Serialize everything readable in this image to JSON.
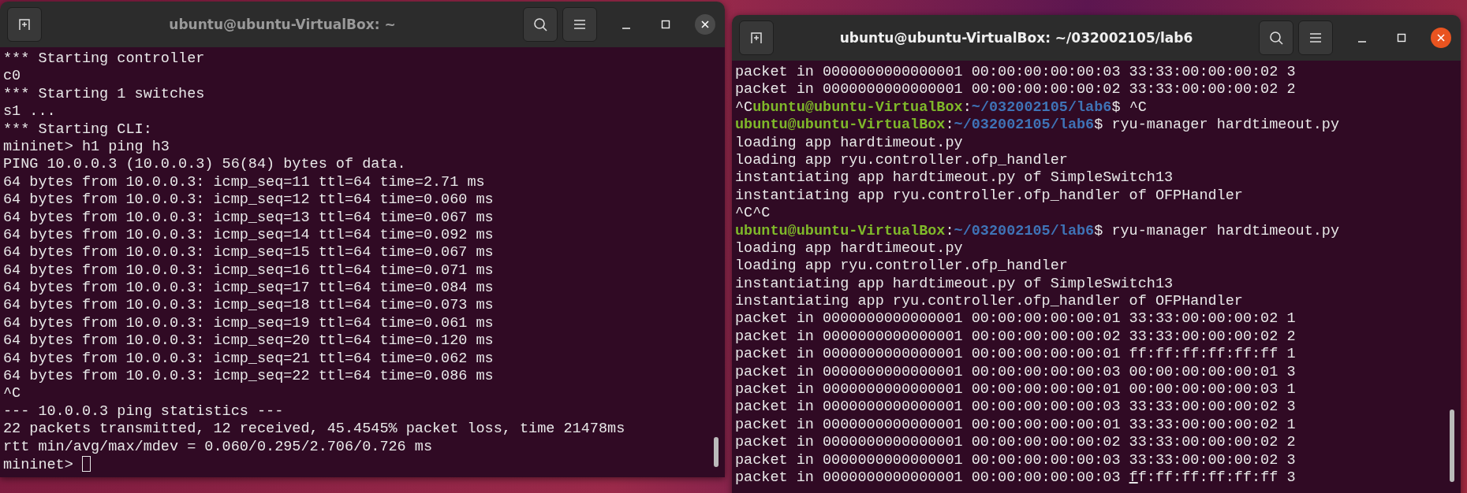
{
  "windows": [
    {
      "title": "ubuntu@ubuntu-VirtualBox: ~",
      "focused": false,
      "lines": [
        {
          "segments": [
            {
              "text": "*** Starting controller",
              "kind": "plain"
            }
          ]
        },
        {
          "segments": [
            {
              "text": "c0",
              "kind": "plain"
            }
          ]
        },
        {
          "segments": [
            {
              "text": "*** Starting 1 switches",
              "kind": "plain"
            }
          ]
        },
        {
          "segments": [
            {
              "text": "s1 ...",
              "kind": "plain"
            }
          ]
        },
        {
          "segments": [
            {
              "text": "*** Starting CLI:",
              "kind": "plain"
            }
          ]
        },
        {
          "segments": [
            {
              "text": "mininet> h1 ping h3",
              "kind": "plain"
            }
          ]
        },
        {
          "segments": [
            {
              "text": "PING 10.0.0.3 (10.0.0.3) 56(84) bytes of data.",
              "kind": "plain"
            }
          ]
        },
        {
          "segments": [
            {
              "text": "64 bytes from 10.0.0.3: icmp_seq=11 ttl=64 time=2.71 ms",
              "kind": "plain"
            }
          ]
        },
        {
          "segments": [
            {
              "text": "64 bytes from 10.0.0.3: icmp_seq=12 ttl=64 time=0.060 ms",
              "kind": "plain"
            }
          ]
        },
        {
          "segments": [
            {
              "text": "64 bytes from 10.0.0.3: icmp_seq=13 ttl=64 time=0.067 ms",
              "kind": "plain"
            }
          ]
        },
        {
          "segments": [
            {
              "text": "64 bytes from 10.0.0.3: icmp_seq=14 ttl=64 time=0.092 ms",
              "kind": "plain"
            }
          ]
        },
        {
          "segments": [
            {
              "text": "64 bytes from 10.0.0.3: icmp_seq=15 ttl=64 time=0.067 ms",
              "kind": "plain"
            }
          ]
        },
        {
          "segments": [
            {
              "text": "64 bytes from 10.0.0.3: icmp_seq=16 ttl=64 time=0.071 ms",
              "kind": "plain"
            }
          ]
        },
        {
          "segments": [
            {
              "text": "64 bytes from 10.0.0.3: icmp_seq=17 ttl=64 time=0.084 ms",
              "kind": "plain"
            }
          ]
        },
        {
          "segments": [
            {
              "text": "64 bytes from 10.0.0.3: icmp_seq=18 ttl=64 time=0.073 ms",
              "kind": "plain"
            }
          ]
        },
        {
          "segments": [
            {
              "text": "64 bytes from 10.0.0.3: icmp_seq=19 ttl=64 time=0.061 ms",
              "kind": "plain"
            }
          ]
        },
        {
          "segments": [
            {
              "text": "64 bytes from 10.0.0.3: icmp_seq=20 ttl=64 time=0.120 ms",
              "kind": "plain"
            }
          ]
        },
        {
          "segments": [
            {
              "text": "64 bytes from 10.0.0.3: icmp_seq=21 ttl=64 time=0.062 ms",
              "kind": "plain"
            }
          ]
        },
        {
          "segments": [
            {
              "text": "64 bytes from 10.0.0.3: icmp_seq=22 ttl=64 time=0.086 ms",
              "kind": "plain"
            }
          ]
        },
        {
          "segments": [
            {
              "text": "^C",
              "kind": "plain"
            }
          ]
        },
        {
          "segments": [
            {
              "text": "--- 10.0.0.3 ping statistics ---",
              "kind": "plain"
            }
          ]
        },
        {
          "segments": [
            {
              "text": "22 packets transmitted, 12 received, 45.4545% packet loss, time 21478ms",
              "kind": "plain"
            }
          ]
        },
        {
          "segments": [
            {
              "text": "rtt min/avg/max/mdev = 0.060/0.295/2.706/0.726 ms",
              "kind": "plain"
            }
          ]
        },
        {
          "segments": [
            {
              "text": "mininet> ",
              "kind": "plain"
            }
          ],
          "cursor_shown": true
        }
      ]
    },
    {
      "title": "ubuntu@ubuntu-VirtualBox: ~/032002105/lab6",
      "focused": true,
      "lines": [
        {
          "segments": [
            {
              "text": "packet in 0000000000000001 00:00:00:00:00:03 33:33:00:00:00:02 3",
              "kind": "plain"
            }
          ]
        },
        {
          "segments": [
            {
              "text": "packet in 0000000000000001 00:00:00:00:00:02 33:33:00:00:00:02 2",
              "kind": "plain"
            }
          ]
        },
        {
          "segments": [
            {
              "text": "^C",
              "kind": "plain"
            },
            {
              "text": "ubuntu@ubuntu-VirtualBox",
              "kind": "user"
            },
            {
              "text": ":",
              "kind": "plain"
            },
            {
              "text": "~/032002105/lab6",
              "kind": "path"
            },
            {
              "text": "$ ^C",
              "kind": "plain"
            }
          ]
        },
        {
          "segments": [
            {
              "text": "ubuntu@ubuntu-VirtualBox",
              "kind": "user"
            },
            {
              "text": ":",
              "kind": "plain"
            },
            {
              "text": "~/032002105/lab6",
              "kind": "path"
            },
            {
              "text": "$ ryu-manager hardtimeout.py",
              "kind": "plain"
            }
          ]
        },
        {
          "segments": [
            {
              "text": "loading app hardtimeout.py",
              "kind": "plain"
            }
          ]
        },
        {
          "segments": [
            {
              "text": "loading app ryu.controller.ofp_handler",
              "kind": "plain"
            }
          ]
        },
        {
          "segments": [
            {
              "text": "instantiating app hardtimeout.py of SimpleSwitch13",
              "kind": "plain"
            }
          ]
        },
        {
          "segments": [
            {
              "text": "instantiating app ryu.controller.ofp_handler of OFPHandler",
              "kind": "plain"
            }
          ]
        },
        {
          "segments": [
            {
              "text": "^C^C",
              "kind": "plain"
            }
          ]
        },
        {
          "segments": [
            {
              "text": "ubuntu@ubuntu-VirtualBox",
              "kind": "user"
            },
            {
              "text": ":",
              "kind": "plain"
            },
            {
              "text": "~/032002105/lab6",
              "kind": "path"
            },
            {
              "text": "$ ryu-manager hardtimeout.py",
              "kind": "plain"
            }
          ]
        },
        {
          "segments": [
            {
              "text": "loading app hardtimeout.py",
              "kind": "plain"
            }
          ]
        },
        {
          "segments": [
            {
              "text": "loading app ryu.controller.ofp_handler",
              "kind": "plain"
            }
          ]
        },
        {
          "segments": [
            {
              "text": "instantiating app hardtimeout.py of SimpleSwitch13",
              "kind": "plain"
            }
          ]
        },
        {
          "segments": [
            {
              "text": "instantiating app ryu.controller.ofp_handler of OFPHandler",
              "kind": "plain"
            }
          ]
        },
        {
          "segments": [
            {
              "text": "packet in 0000000000000001 00:00:00:00:00:01 33:33:00:00:00:02 1",
              "kind": "plain"
            }
          ]
        },
        {
          "segments": [
            {
              "text": "packet in 0000000000000001 00:00:00:00:00:02 33:33:00:00:00:02 2",
              "kind": "plain"
            }
          ]
        },
        {
          "segments": [
            {
              "text": "packet in 0000000000000001 00:00:00:00:00:01 ff:ff:ff:ff:ff:ff 1",
              "kind": "plain"
            }
          ]
        },
        {
          "segments": [
            {
              "text": "packet in 0000000000000001 00:00:00:00:00:03 00:00:00:00:00:01 3",
              "kind": "plain"
            }
          ]
        },
        {
          "segments": [
            {
              "text": "packet in 0000000000000001 00:00:00:00:00:01 00:00:00:00:00:03 1",
              "kind": "plain"
            }
          ]
        },
        {
          "segments": [
            {
              "text": "packet in 0000000000000001 00:00:00:00:00:03 33:33:00:00:00:02 3",
              "kind": "plain"
            }
          ]
        },
        {
          "segments": [
            {
              "text": "packet in 0000000000000001 00:00:00:00:00:01 33:33:00:00:00:02 1",
              "kind": "plain"
            }
          ]
        },
        {
          "segments": [
            {
              "text": "packet in 0000000000000001 00:00:00:00:00:02 33:33:00:00:00:02 2",
              "kind": "plain"
            }
          ]
        },
        {
          "segments": [
            {
              "text": "packet in 0000000000000001 00:00:00:00:00:03 33:33:00:00:00:02 3",
              "kind": "plain"
            }
          ]
        },
        {
          "segments": [
            {
              "text": "packet in 0000000000000001 00:00:00:00:00:03 ",
              "kind": "plain"
            },
            {
              "text": "f",
              "kind": "cursor"
            },
            {
              "text": "f:ff:ff:ff:ff:ff 3",
              "kind": "plain"
            }
          ]
        }
      ]
    }
  ]
}
